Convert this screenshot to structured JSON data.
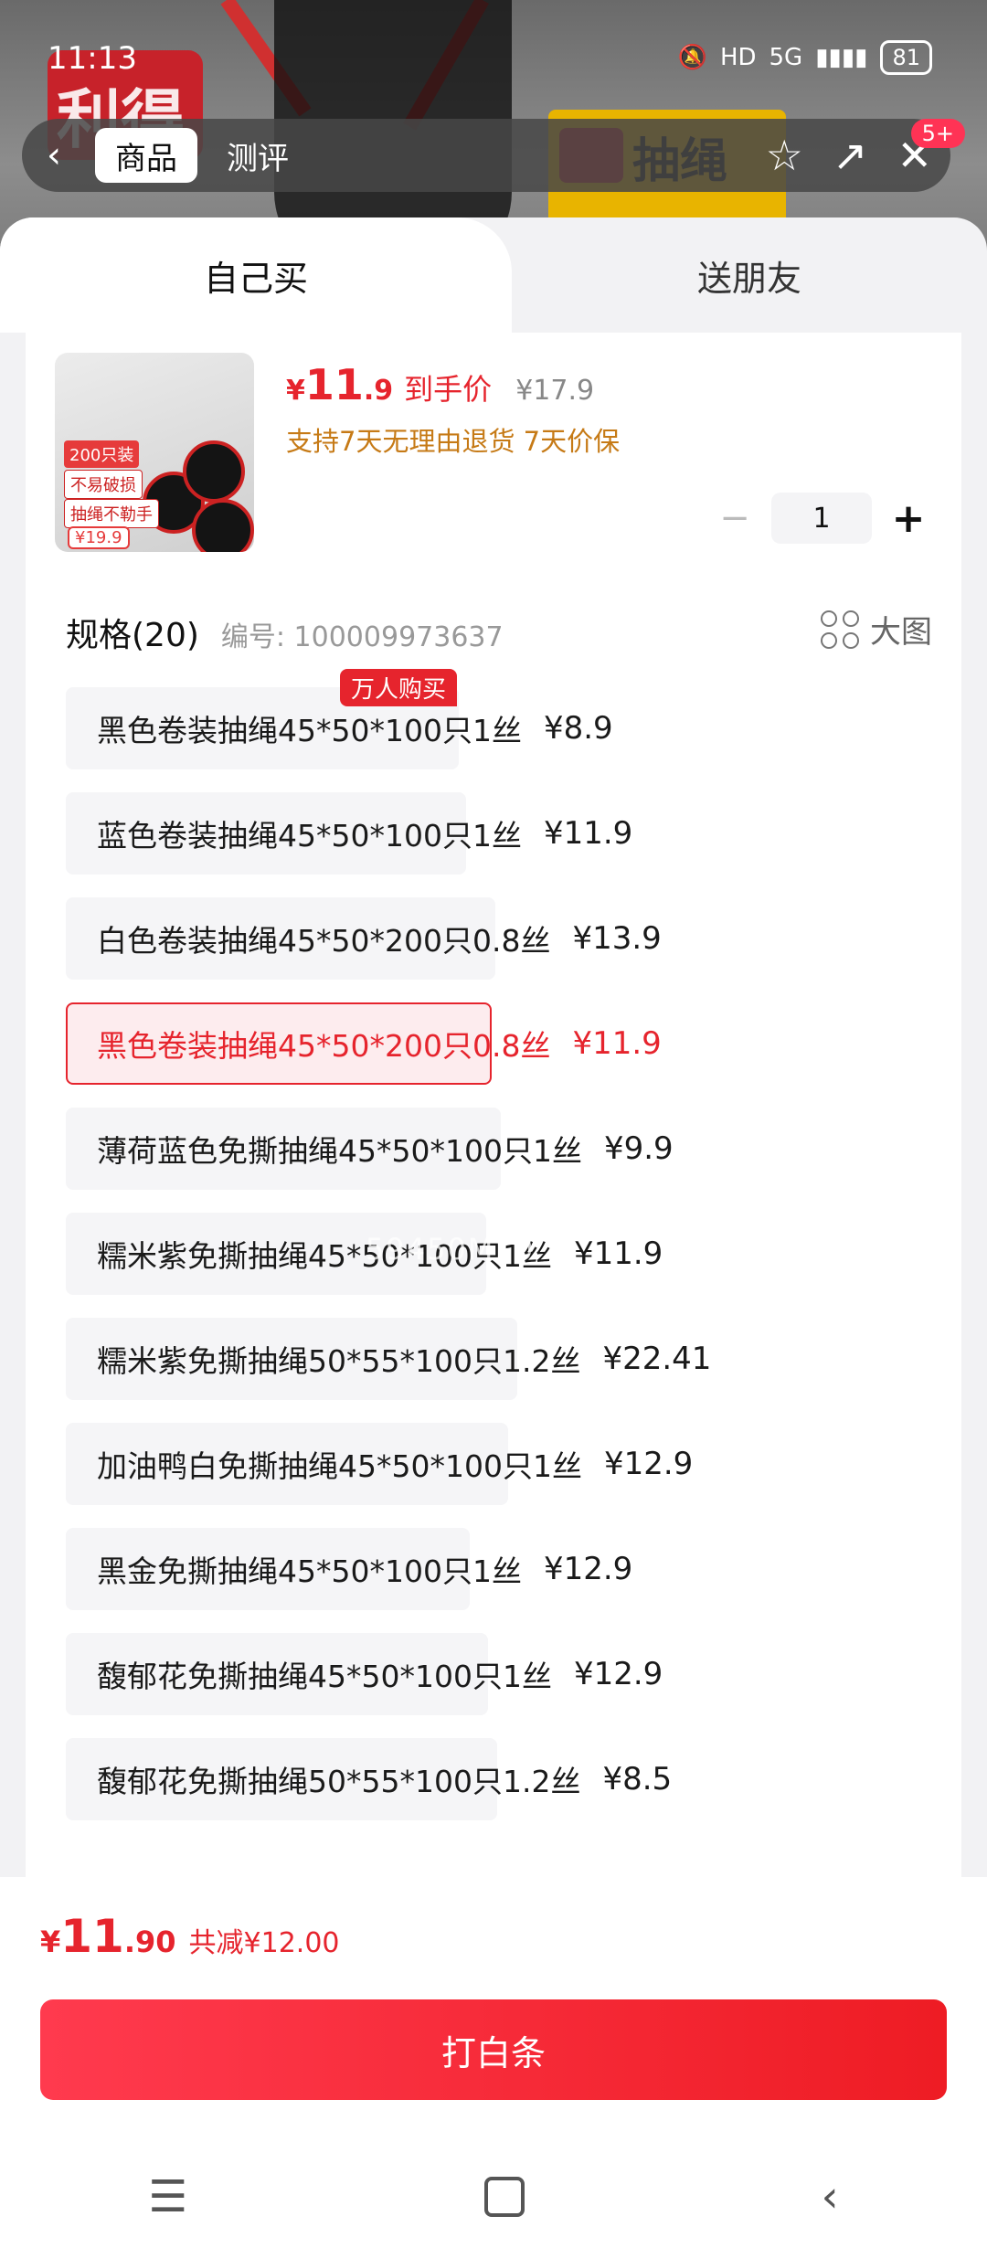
{
  "status": {
    "time": "11:13",
    "network": "5G",
    "hd": "HD",
    "battery": "81"
  },
  "topnav": {
    "back_icon": "chevron-left-icon",
    "tabs": [
      "商品",
      "测评"
    ],
    "active_tab": 0,
    "notification_badge": "5+"
  },
  "background": {
    "brand_logo": "利得",
    "pack_text": "抽绳"
  },
  "sheet_tabs": {
    "own": "自己买",
    "friend": "送朋友"
  },
  "product": {
    "price_currency": "¥",
    "price_int": "11",
    "price_dec": ".9",
    "price_label": "到手价",
    "original_price": "¥17.9",
    "support_text": "支持7天无理由退货  7天价保",
    "thumb_tags": [
      "200只装",
      "不易破损",
      "抽绳不勒手"
    ],
    "thumb_price": "¥19.9"
  },
  "quantity": {
    "minus": "−",
    "value": "1",
    "plus": "+"
  },
  "spec": {
    "title": "规格(20)",
    "code": "编号: 100009973637",
    "big_image_label": "大图",
    "items": [
      {
        "name": "黑色卷装抽绳45*50*100只1丝",
        "price": "¥8.9",
        "badge": "万人购买",
        "thumb_color": "#222222"
      },
      {
        "name": "蓝色卷装抽绳45*50*100只1丝",
        "price": "¥11.9",
        "badge": "",
        "thumb_color": "#6b8dc4"
      },
      {
        "name": "白色卷装抽绳45*50*200只0.8丝",
        "price": "¥13.9",
        "badge": "",
        "thumb_color": "#d9e6f2"
      },
      {
        "name": "黑色卷装抽绳45*50*200只0.8丝",
        "price": "¥11.9",
        "badge": "",
        "thumb_color": "#222222",
        "selected": true
      },
      {
        "name": "薄荷蓝色免撕抽绳45*50*100只1丝",
        "price": "¥9.9",
        "badge": "",
        "thumb_color": "#8fd3d9"
      },
      {
        "name": "糯米紫免撕抽绳45*50*100只1丝",
        "price": "¥11.9",
        "badge": "",
        "thumb_color": "#d9b8e8"
      },
      {
        "name": "糯米紫免撕抽绳50*55*100只1.2丝",
        "price": "¥22.41",
        "badge": "",
        "thumb_color": "#caa8e0"
      },
      {
        "name": "加油鸭白免撕抽绳45*50*100只1丝",
        "price": "¥12.9",
        "badge": "",
        "thumb_color": "#f2c6c6"
      },
      {
        "name": "黑金免撕抽绳45*50*100只1丝",
        "price": "¥12.9",
        "badge": "",
        "thumb_color": "#151515"
      },
      {
        "name": "馥郁花免撕抽绳45*50*100只1丝",
        "price": "¥12.9",
        "badge": "",
        "thumb_color": "#e8d6e0"
      },
      {
        "name": "馥郁花免撕抽绳50*55*100只1.2丝",
        "price": "¥8.5",
        "badge": "",
        "thumb_color": "#cfe3cf"
      }
    ]
  },
  "watermark": "59450MT0",
  "footer": {
    "total_currency": "¥",
    "total_int": "11",
    "total_dec": ".90",
    "total_save": "共减¥12.00",
    "pay_button": "打白条"
  },
  "colors": {
    "accent": "#e6242d",
    "support": "#c67a16"
  }
}
